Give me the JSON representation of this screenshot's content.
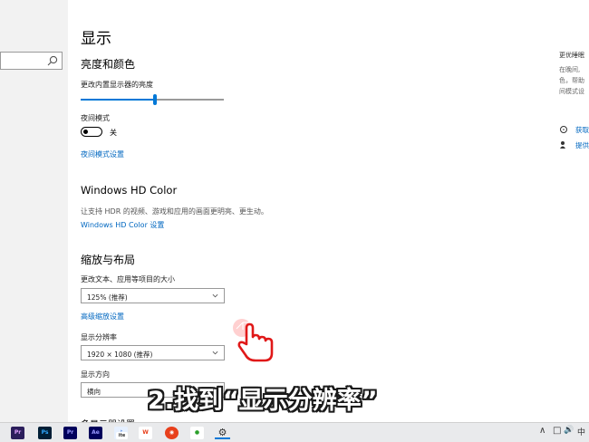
{
  "main": {
    "title": "显示",
    "brightness": {
      "section_title": "亮度和颜色",
      "slider_label": "更改内置显示器的亮度",
      "slider_level": 0.52
    },
    "night_light": {
      "label": "夜间模式",
      "toggle_state": "关",
      "settings_link": "夜间模式设置"
    },
    "hdr": {
      "title": "Windows HD Color",
      "description": "让支持 HDR 的视频、游戏和应用的画面更明亮、更生动。",
      "settings_link": "Windows HD Color 设置"
    },
    "scale": {
      "section_title": "缩放与布局",
      "size_label": "更改文本、应用等项目的大小",
      "size_value": "125% (推荐)",
      "advanced_link": "高级缩放设置",
      "resolution_label": "显示分辨率",
      "resolution_value": "1920 × 1080 (推荐)",
      "orientation_label": "显示方向",
      "orientation_value": "横向"
    },
    "bottom_partial": "多显示器设置"
  },
  "right_panel": {
    "title": "更优睡眠",
    "lines": [
      "在晚间,",
      "色，帮助",
      "间模式设"
    ],
    "links": [
      "获取",
      "提供"
    ]
  },
  "caption": "2.找到“显示分辨率”",
  "taskbar": {
    "apps": [
      {
        "label": "Pr",
        "color": "#2b1e5c",
        "fg": "#e0a0ff"
      },
      {
        "label": "Ps",
        "color": "#001e36",
        "fg": "#31a8ff"
      },
      {
        "label": "Pr",
        "color": "#00005b",
        "fg": "#9999ff"
      },
      {
        "label": "Ae",
        "color": "#00005b",
        "fg": "#9999ff"
      },
      {
        "label": "♪",
        "color": "#e6f0ff",
        "fg": "#1a5fd6"
      },
      {
        "label": "ite",
        "color": "#ffffff",
        "fg": "#333333"
      },
      {
        "label": "W",
        "color": "#ffffff",
        "fg": "#e8401c"
      },
      {
        "label": "◉",
        "color": "#e8401c",
        "fg": "#ffffff"
      },
      {
        "label": "●",
        "color": "#ffffff",
        "fg": "#2ca02c"
      },
      {
        "label": "⚙",
        "color": "#e9eaec",
        "fg": "#333333"
      }
    ],
    "tray": [
      "∧",
      "□",
      "🔊",
      "中"
    ]
  }
}
